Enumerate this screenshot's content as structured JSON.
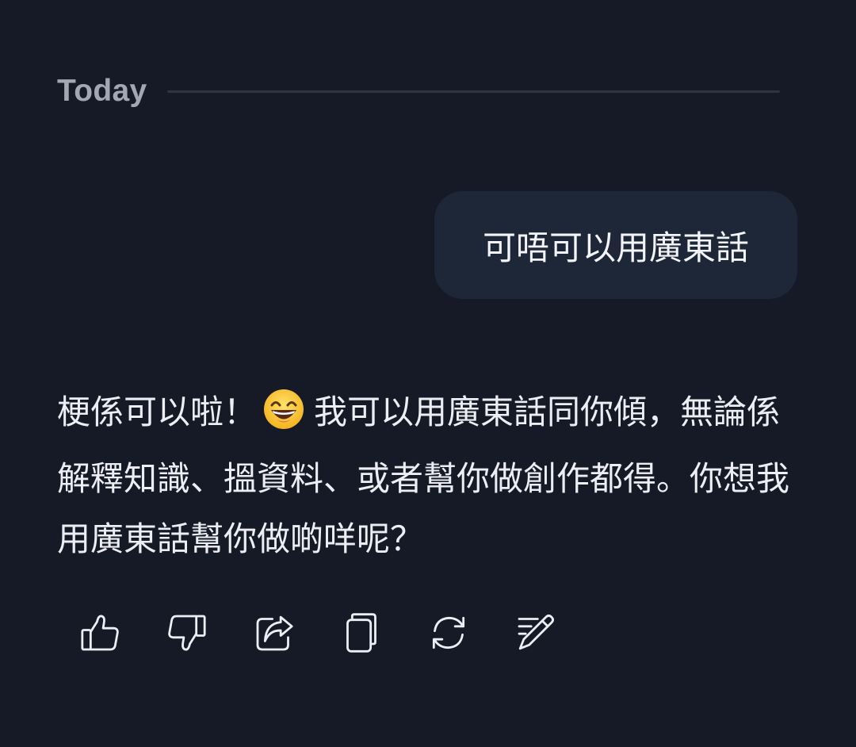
{
  "divider": {
    "label": "Today"
  },
  "user_message": {
    "text": "可唔可以用廣東話"
  },
  "assistant_message": {
    "text_before_emoji": "梗係可以啦！",
    "emoji_name": "grinning-face-with-smiling-eyes",
    "text_after_emoji": "我可以用廣東話同你傾，無論係解釋知識、搵資料、或者幫你做創作都得。你想我用廣東話幫你做啲咩呢？"
  },
  "actions": [
    {
      "icon": "thumbs-up-icon"
    },
    {
      "icon": "thumbs-down-icon"
    },
    {
      "icon": "share-icon"
    },
    {
      "icon": "copy-icon"
    },
    {
      "icon": "regenerate-icon"
    },
    {
      "icon": "edit-icon"
    }
  ],
  "colors": {
    "background": "#161a27",
    "bubble": "#1e2738",
    "text": "#eceef3",
    "muted": "#a3a7b3"
  }
}
